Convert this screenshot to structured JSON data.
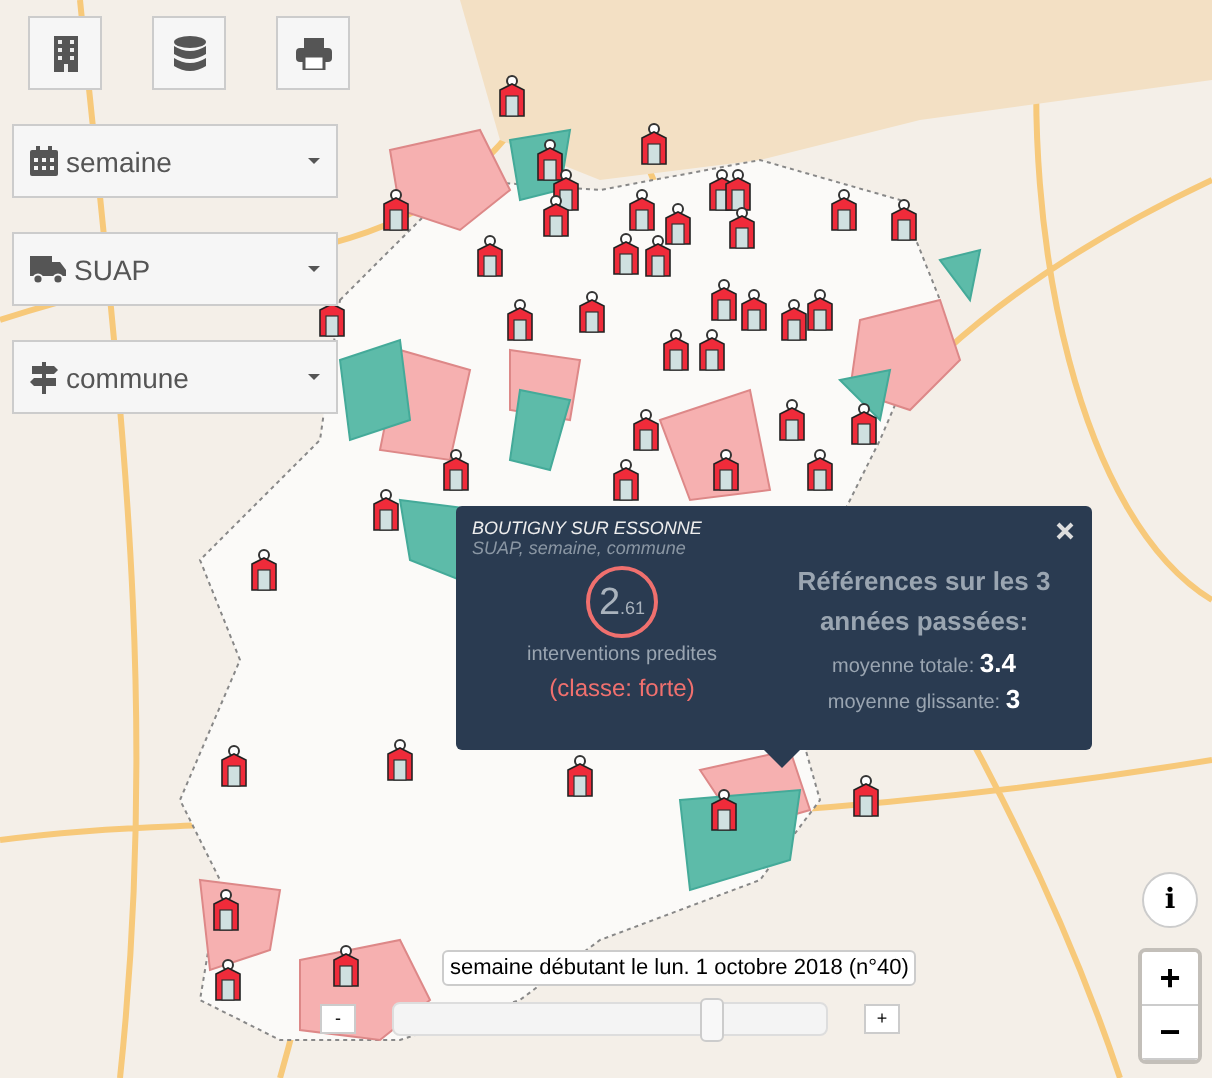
{
  "filters": [
    {
      "label": "semaine"
    },
    {
      "label": "SUAP"
    },
    {
      "label": "commune"
    }
  ],
  "popup": {
    "title": "BOUTIGNY SUR ESSONNE",
    "subtitle": "SUAP, semaine, commune",
    "value_integer": "2",
    "value_decimal": ".61",
    "value_label": "interventions predites",
    "class_label": "(classe: forte)",
    "references_title": "Références sur les 3 années passées:",
    "references": [
      {
        "label": "moyenne totale:",
        "value": "3.4"
      },
      {
        "label": "moyenne glissante:",
        "value": "3"
      }
    ]
  },
  "timeline": {
    "label": "semaine débutant le lun. 1 octobre 2018 (n°40)",
    "minus": "-",
    "plus": "+",
    "level": 0.73
  },
  "zoom": {
    "in": "+",
    "out": "−"
  },
  "info": "i"
}
